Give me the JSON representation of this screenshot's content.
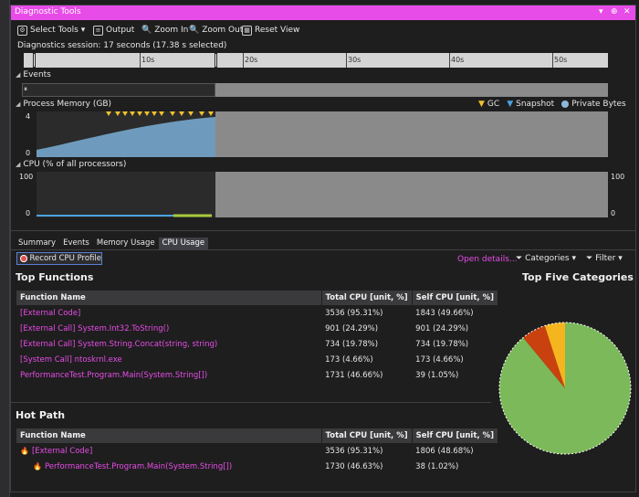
{
  "window": {
    "title": "Diagnostic Tools"
  },
  "toolbar": {
    "select_tools": "Select Tools",
    "output": "Output",
    "zoom_in": "Zoom In",
    "zoom_out": "Zoom Out",
    "reset_view": "Reset View"
  },
  "session_text": "Diagnostics session: 17 seconds (17.38 s selected)",
  "ruler_labels": [
    "10s",
    "20s",
    "30s",
    "40s",
    "50s"
  ],
  "events_label": "Events",
  "memory": {
    "title": "Process Memory (GB)",
    "y_max": "4",
    "y_min": "0",
    "legend": {
      "gc": "GC",
      "snapshot": "Snapshot",
      "private": "Private Bytes"
    },
    "colors": {
      "gc": "#f2c12e",
      "snapshot": "#4aa3df",
      "private": "#8fb8d8",
      "area": "#6e9bbd"
    }
  },
  "cpu": {
    "title": "CPU (% of all processors)",
    "y_max_left": "100",
    "y_min_left": "0",
    "y_max_right": "100",
    "y_min_right": "0"
  },
  "tabs": [
    {
      "label": "Summary"
    },
    {
      "label": "Events"
    },
    {
      "label": "Memory Usage"
    },
    {
      "label": "CPU Usage",
      "active": true
    }
  ],
  "record_button": "Record CPU Profile",
  "open_details": "Open details...",
  "categories": "Categories",
  "filter": "Filter",
  "top_functions": {
    "heading": "Top Functions",
    "columns": [
      "Function Name",
      "Total CPU [unit, %]",
      "Self CPU [unit, %]"
    ],
    "rows": [
      [
        "[External Code]",
        "3536 (95.31%)",
        "1843 (49.66%)"
      ],
      [
        "[External Call] System.Int32.ToString()",
        "901 (24.29%)",
        "901 (24.29%)"
      ],
      [
        "[External Call] System.String.Concat(string, string)",
        "734 (19.78%)",
        "734 (19.78%)"
      ],
      [
        "[System Call] ntoskrnl.exe",
        "173 (4.66%)",
        "173 (4.66%)"
      ],
      [
        "PerformanceTest.Program.Main(System.String[])",
        "1731 (46.66%)",
        "39 (1.05%)"
      ]
    ]
  },
  "hot_path": {
    "heading": "Hot Path",
    "columns": [
      "Function Name",
      "Total CPU [unit, %]",
      "Self CPU [unit, %]"
    ],
    "rows": [
      [
        "[External Code]",
        "3536 (95.31%)",
        "1806 (48.68%)"
      ],
      [
        "PerformanceTest.Program.Main(System.String[])",
        "1730 (46.63%)",
        "38 (1.02%)"
      ]
    ]
  },
  "top_categories": {
    "heading": "Top Five Categories",
    "slices": [
      {
        "percent": 89,
        "color": "#7cb95a"
      },
      {
        "percent": 6,
        "color": "#c9410e"
      },
      {
        "percent": 5,
        "color": "#f5b51e"
      }
    ]
  }
}
